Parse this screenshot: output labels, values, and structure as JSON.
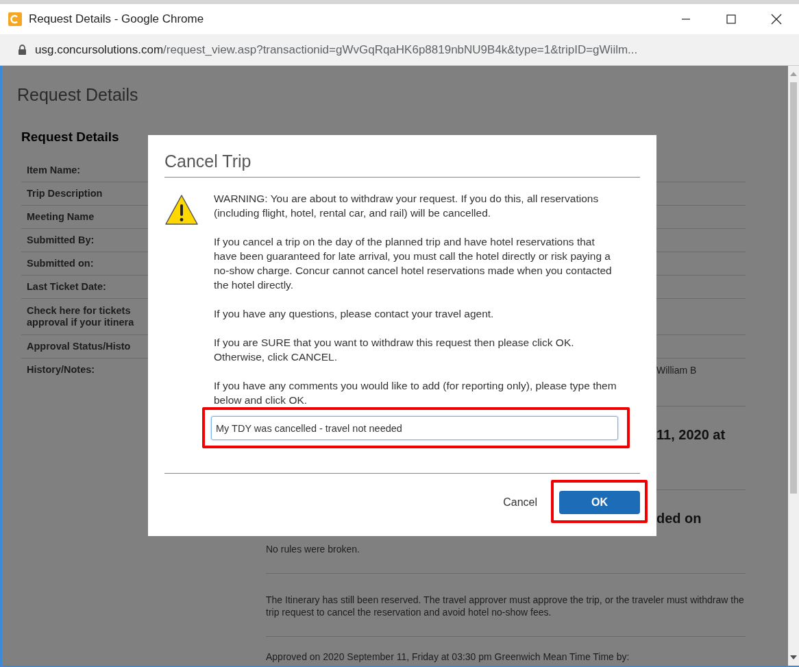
{
  "window": {
    "title": "Request Details - Google Chrome"
  },
  "address_bar": {
    "host": "usg.concursolutions.com",
    "path": "/request_view.asp?transactionid=gWvGqRqaHK6p8819nbNU9B4k&type=1&tripID=gWiilm..."
  },
  "page": {
    "title": "Request Details",
    "section_title": "Request Details",
    "fields": [
      {
        "label": "Item Name:"
      },
      {
        "label": "Trip Description"
      },
      {
        "label": "Meeting Name"
      },
      {
        "label": "Submitted By:"
      },
      {
        "label": "Submitted on:"
      },
      {
        "label": "Last Ticket Date:"
      },
      {
        "label": "Check here for tickets\napproval if your itinera"
      },
      {
        "label": "Approval Status/Histo"
      },
      {
        "label": "History/Notes:"
      }
    ],
    "history": [
      {
        "kind": "text",
        "text": "William B",
        "offset": true
      },
      {
        "kind": "rule"
      },
      {
        "kind": "heading",
        "text": "11, 2020 at",
        "offset": true
      },
      {
        "kind": "rule"
      },
      {
        "kind": "heading",
        "text": "ded on",
        "offset": true
      },
      {
        "kind": "text",
        "text": "No rules were broken.",
        "offset": false
      },
      {
        "kind": "rule"
      },
      {
        "kind": "text",
        "text": "The Itinerary has still been reserved. The travel approver must approve the trip, or the traveler must withdraw the trip request to cancel the reservation and avoid hotel no-show fees.",
        "offset": false
      },
      {
        "kind": "rule"
      },
      {
        "kind": "text",
        "text": "Approved on 2020 September 11, Friday at 03:30 pm Greenwich Mean Time Time by:",
        "offset": false
      }
    ]
  },
  "dialog": {
    "title": "Cancel Trip",
    "paragraphs": [
      "WARNING: You are about to withdraw your request. If you do this, all reservations (including flight, hotel, rental car, and rail) will be cancelled.",
      "If you cancel a trip on the day of the planned trip and have hotel reservations that have been guaranteed for late arrival, you must call the hotel directly or risk paying a no-show charge. Concur cannot cancel hotel reservations made when you contacted the hotel directly.",
      "If you have any questions, please contact your travel agent.",
      "If you are SURE that you want to withdraw this request then please click OK. Otherwise, click CANCEL.",
      "If you have any comments you would like to add (for reporting only), please type them below and click OK."
    ],
    "comment": {
      "value": "My TDY was cancelled - travel not needed ",
      "highlighted": true
    },
    "cancel": "Cancel",
    "ok": {
      "label": "OK",
      "highlighted": true
    }
  }
}
